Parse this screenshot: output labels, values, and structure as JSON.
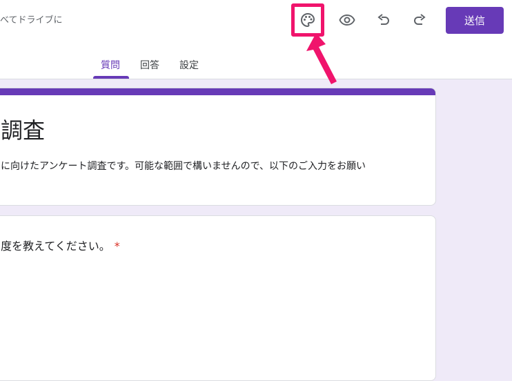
{
  "header": {
    "save_status": "べてドライブに",
    "send_label": "送信"
  },
  "tabs": [
    {
      "label": "質問"
    },
    {
      "label": "回答"
    },
    {
      "label": "設定"
    }
  ],
  "form": {
    "title": "調査",
    "description": "に向けたアンケート調査です。可能な範囲で構いませんので、以下のご入力をお願い",
    "question": "度を教えてください。",
    "required_mark": "*"
  },
  "colors": {
    "accent": "#673ab7",
    "highlight": "#f0146c",
    "background": "#efeaf8"
  }
}
